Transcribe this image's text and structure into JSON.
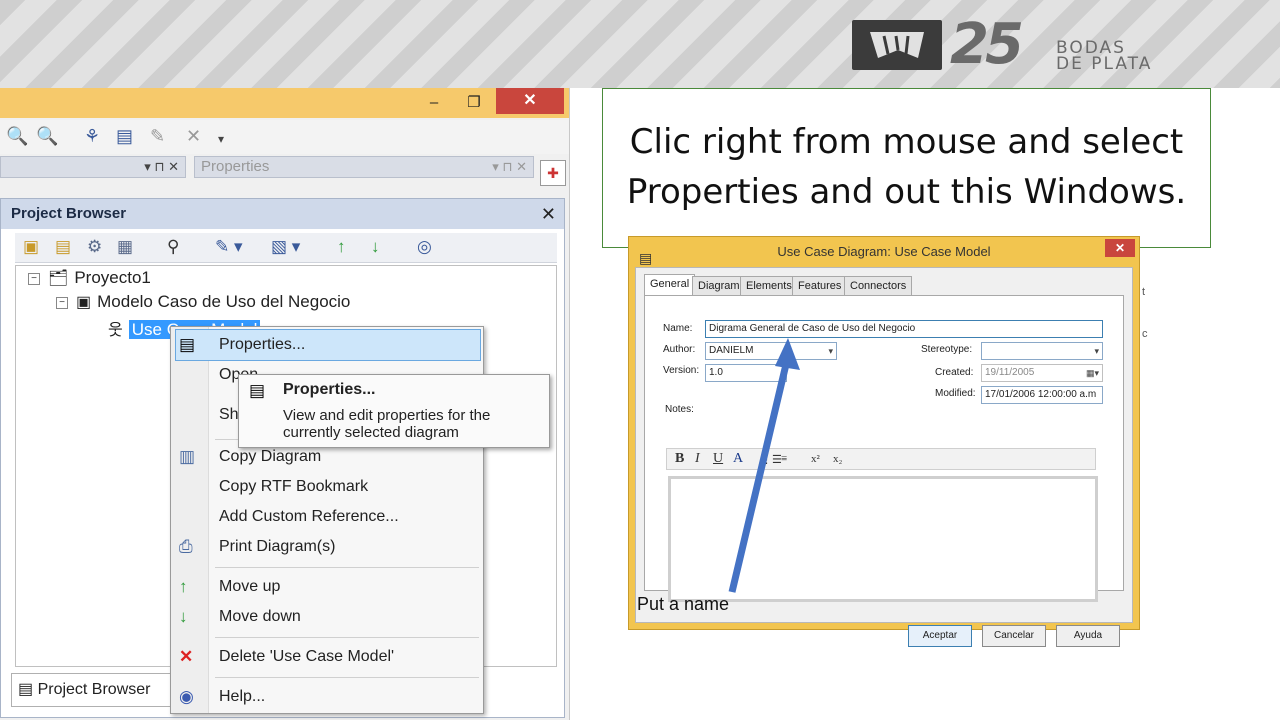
{
  "banner": {
    "logo_number": "25",
    "logo_line1": "BODAS",
    "logo_line2": "DE PLATA"
  },
  "ea_window": {
    "min_glyph": "–",
    "max_glyph": "❐",
    "close_glyph": "✕",
    "left_panel_controls": "▾ ⊓ ✕",
    "properties_panel": "Properties",
    "properties_controls": "▾ ⊓ ✕"
  },
  "project_browser": {
    "title": "Project Browser",
    "close": "✕",
    "tree": [
      {
        "label": "Proyecto1",
        "expander": "−"
      },
      {
        "label": "Modelo Caso de Uso del Negocio",
        "expander": "−"
      },
      {
        "label": "Use Case Model"
      }
    ],
    "footer_tab": "Project Browser"
  },
  "context_menu": {
    "items": [
      {
        "label": "Properties...",
        "icon": "properties-icon"
      },
      {
        "label": "Open"
      },
      {
        "label": "Show"
      },
      {
        "label": "Copy Diagram",
        "icon": "copy-icon"
      },
      {
        "label": "Copy RTF Bookmark"
      },
      {
        "label": "Add Custom Reference..."
      },
      {
        "label": "Print Diagram(s)",
        "icon": "printer-icon"
      },
      {
        "label": "Move up",
        "icon": "arrow-up-icon"
      },
      {
        "label": "Move down",
        "icon": "arrow-down-icon"
      },
      {
        "label": "Delete 'Use Case Model'",
        "icon": "delete-icon"
      },
      {
        "label": "Help...",
        "icon": "help-icon"
      }
    ]
  },
  "tooltip": {
    "title": "Properties...",
    "description": "View and edit properties for the currently selected diagram"
  },
  "callout": {
    "line1": "Clic right from mouse and select",
    "line2": "Properties and out this Windows."
  },
  "dialog": {
    "title": "Use Case Diagram: Use Case Model",
    "close": "✕",
    "tabs": [
      "General",
      "Diagram",
      "Elements",
      "Features",
      "Connectors"
    ],
    "name_label": "Name:",
    "name_value": "Digrama General de Caso de Uso del Negocio",
    "author_label": "Author:",
    "author_value": "DANIELM",
    "version_label": "Version:",
    "version_value": "1.0",
    "stereotype_label": "Stereotype:",
    "stereotype_value": "",
    "created_label": "Created:",
    "created_value": "19/11/2005",
    "modified_label": "Modified:",
    "modified_value": "17/01/2006 12:00:00 a.m",
    "notes_label": "Notes:",
    "format_bold": "B",
    "format_italic": "I",
    "format_underline": "U",
    "format_color": "A",
    "format_superscript": "x²",
    "format_subscript": "x₂",
    "ok": "Aceptar",
    "cancel": "Cancelar",
    "help": "Ayuda"
  },
  "annotation": {
    "put_name": "Put a name",
    "arrow_color": "#4472c4"
  },
  "right_edge": {
    "char1": "t",
    "char2": "c"
  }
}
